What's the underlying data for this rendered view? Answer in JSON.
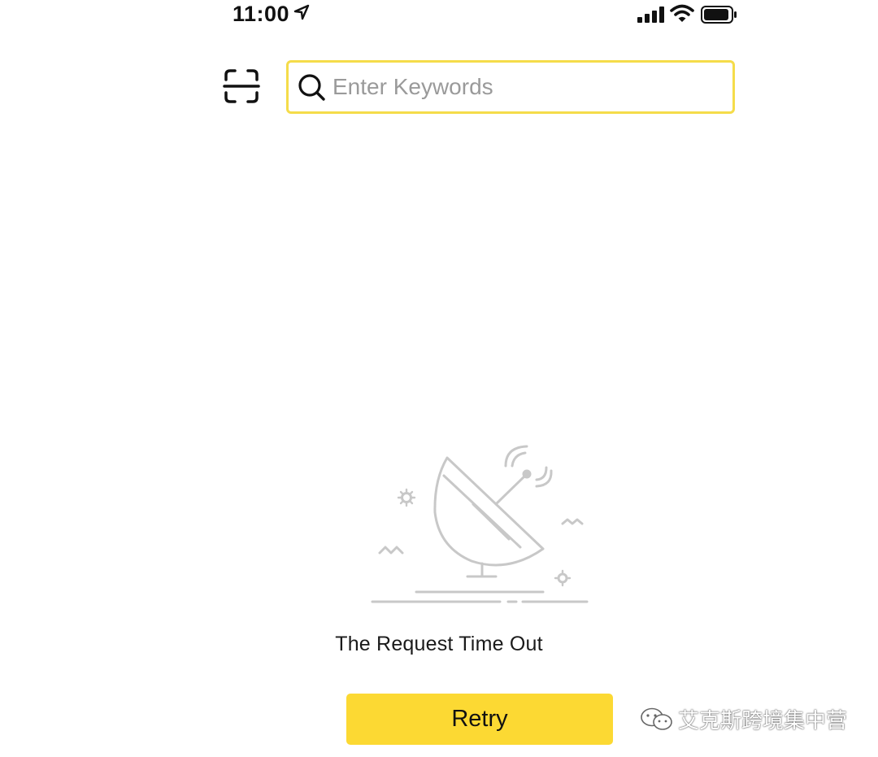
{
  "status_bar": {
    "time": "11:00",
    "icons": [
      "location-arrow-icon",
      "cellular-signal-icon",
      "wifi-icon",
      "battery-icon"
    ]
  },
  "search": {
    "placeholder": "Enter Keywords",
    "value": "",
    "scan_icon": "scan-icon",
    "search_icon": "search-icon"
  },
  "error": {
    "illustration": "satellite-dish-icon",
    "message": "The Request Time Out",
    "retry_label": "Retry"
  },
  "watermark": {
    "text": "艾克斯跨境集中营",
    "icon": "wechat-icon"
  },
  "colors": {
    "accent": "#fcd933",
    "search_border": "#f5dc4a",
    "illustration_stroke": "#c8c8c8"
  }
}
